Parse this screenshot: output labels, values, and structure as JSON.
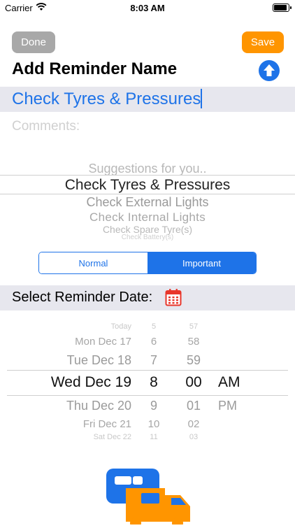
{
  "status_bar": {
    "carrier": "Carrier",
    "time": "8:03 AM"
  },
  "header": {
    "done_label": "Done",
    "save_label": "Save",
    "title": "Add Reminder Name"
  },
  "reminder": {
    "name_value": "Check Tyres & Pressures",
    "comments_placeholder": "Comments:"
  },
  "suggestions": {
    "title": "Suggestions for you..",
    "selected": "Check Tyres & Pressures",
    "below": [
      "Check External Lights",
      "Check Internal Lights",
      "Check Spare Tyre(s)",
      "Check Battery(s)"
    ]
  },
  "priority": {
    "options": [
      "Normal",
      "Important"
    ],
    "selected": "Important"
  },
  "date": {
    "label": "Select Reminder Date:",
    "days": [
      "Today",
      "Mon Dec 17",
      "Tue Dec 18",
      "Wed Dec 19",
      "Thu Dec 20",
      "Fri Dec 21",
      "Sat Dec 22"
    ],
    "hours": [
      "5",
      "6",
      "7",
      "8",
      "9",
      "10",
      "11"
    ],
    "minutes": [
      "57",
      "58",
      "59",
      "00",
      "01",
      "02",
      "03"
    ],
    "ampm_selected": "AM",
    "ampm_below": "PM"
  },
  "colors": {
    "accent": "#1e73e8",
    "save": "#ff9500",
    "done": "#a8a8a8",
    "calendar": "#e8362a"
  },
  "icons": [
    "wifi-icon",
    "battery-icon",
    "upload-arrow-icon",
    "calendar-icon",
    "caravan-logo-icon"
  ]
}
